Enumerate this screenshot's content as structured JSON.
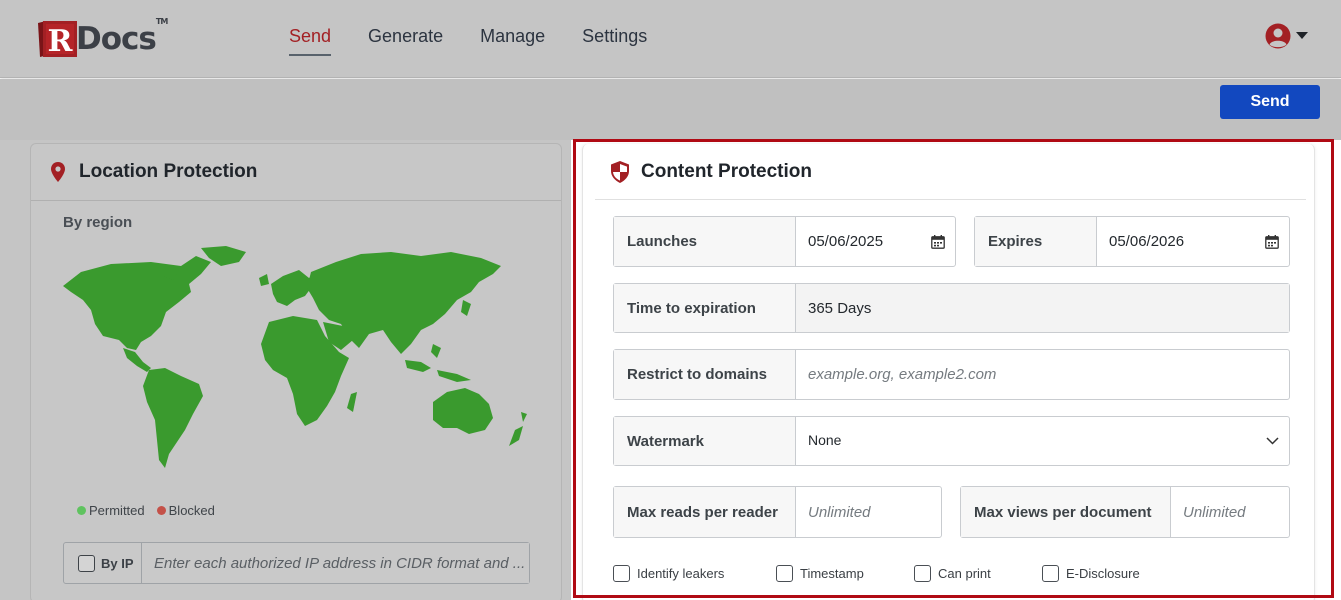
{
  "app": {
    "logo_text": "Docs",
    "logo_letter": "R",
    "logo_tm": "TM",
    "brand_color": "#a32024"
  },
  "nav": {
    "items": [
      {
        "label": "Send",
        "active": true
      },
      {
        "label": "Generate",
        "active": false
      },
      {
        "label": "Manage",
        "active": false
      },
      {
        "label": "Settings",
        "active": false
      }
    ]
  },
  "user_menu": {
    "icon": "user-circle-icon",
    "caret": "caret-down-icon"
  },
  "toolbar": {
    "send_label": "Send",
    "send_color": "#1248bf"
  },
  "location_protection": {
    "title": "Location Protection",
    "icon": "map-pin-icon",
    "region_label": "By region",
    "legend": [
      {
        "label": "Permitted",
        "color": "#5fc35f"
      },
      {
        "label": "Blocked",
        "color": "#c45148"
      }
    ],
    "ip": {
      "checkbox_label": "By IP",
      "placeholder": "Enter each authorized IP address in CIDR format and ..."
    }
  },
  "content_protection": {
    "title": "Content Protection",
    "icon": "shield-icon",
    "launches": {
      "label": "Launches",
      "value": "05/06/2025"
    },
    "expires": {
      "label": "Expires",
      "value": "05/06/2026"
    },
    "time_to_expiration": {
      "label": "Time to expiration",
      "value": "365 Days"
    },
    "restrict_domains": {
      "label": "Restrict to domains",
      "placeholder": "example.org, example2.com"
    },
    "watermark": {
      "label": "Watermark",
      "value": "None"
    },
    "max_reads": {
      "label": "Max reads per reader",
      "placeholder": "Unlimited"
    },
    "max_views": {
      "label": "Max views per document",
      "placeholder": "Unlimited"
    },
    "options": [
      {
        "label": "Identify leakers",
        "checked": false
      },
      {
        "label": "Timestamp",
        "checked": false
      },
      {
        "label": "Can print",
        "checked": false
      },
      {
        "label": "E-Disclosure",
        "checked": false
      }
    ],
    "highlight_color": "#b00a14"
  }
}
